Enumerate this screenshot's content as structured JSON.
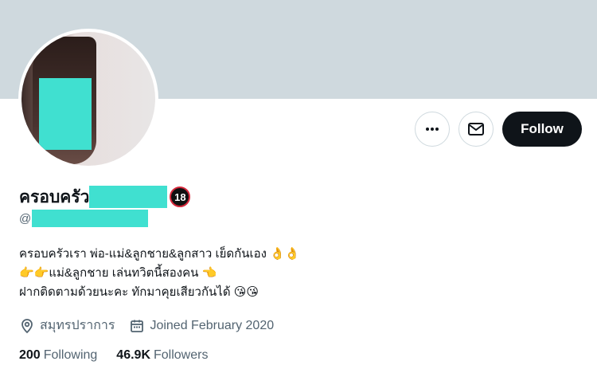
{
  "profile": {
    "display_name_prefix": "ครอบครัว",
    "age_badge": "18",
    "handle_prefix": "@",
    "bio_lines": [
      "ครอบครัวเรา พ่อ-แม่&ลูกชาย&ลูกสาว เย็ดกันเอง 👌👌",
      "👉👉แม่&ลูกชาย เล่นทวิตนี้สองคน 👈",
      "ฝากติดตามด้วยนะคะ ทักมาคุยเสียวกันได้ 😘😘"
    ],
    "location": "สมุทรปราการ",
    "joined": "Joined February 2020",
    "following_count": "200",
    "following_label": "Following",
    "followers_count": "46.9K",
    "followers_label": "Followers"
  },
  "actions": {
    "follow_label": "Follow"
  },
  "icons": {
    "more": "more-horizontal-icon",
    "message": "envelope-icon",
    "location": "location-pin-icon",
    "calendar": "calendar-icon"
  },
  "colors": {
    "banner": "#cfd9de",
    "follow_bg": "#0f1419",
    "redaction": "#40e0d0",
    "muted_text": "#536471"
  }
}
